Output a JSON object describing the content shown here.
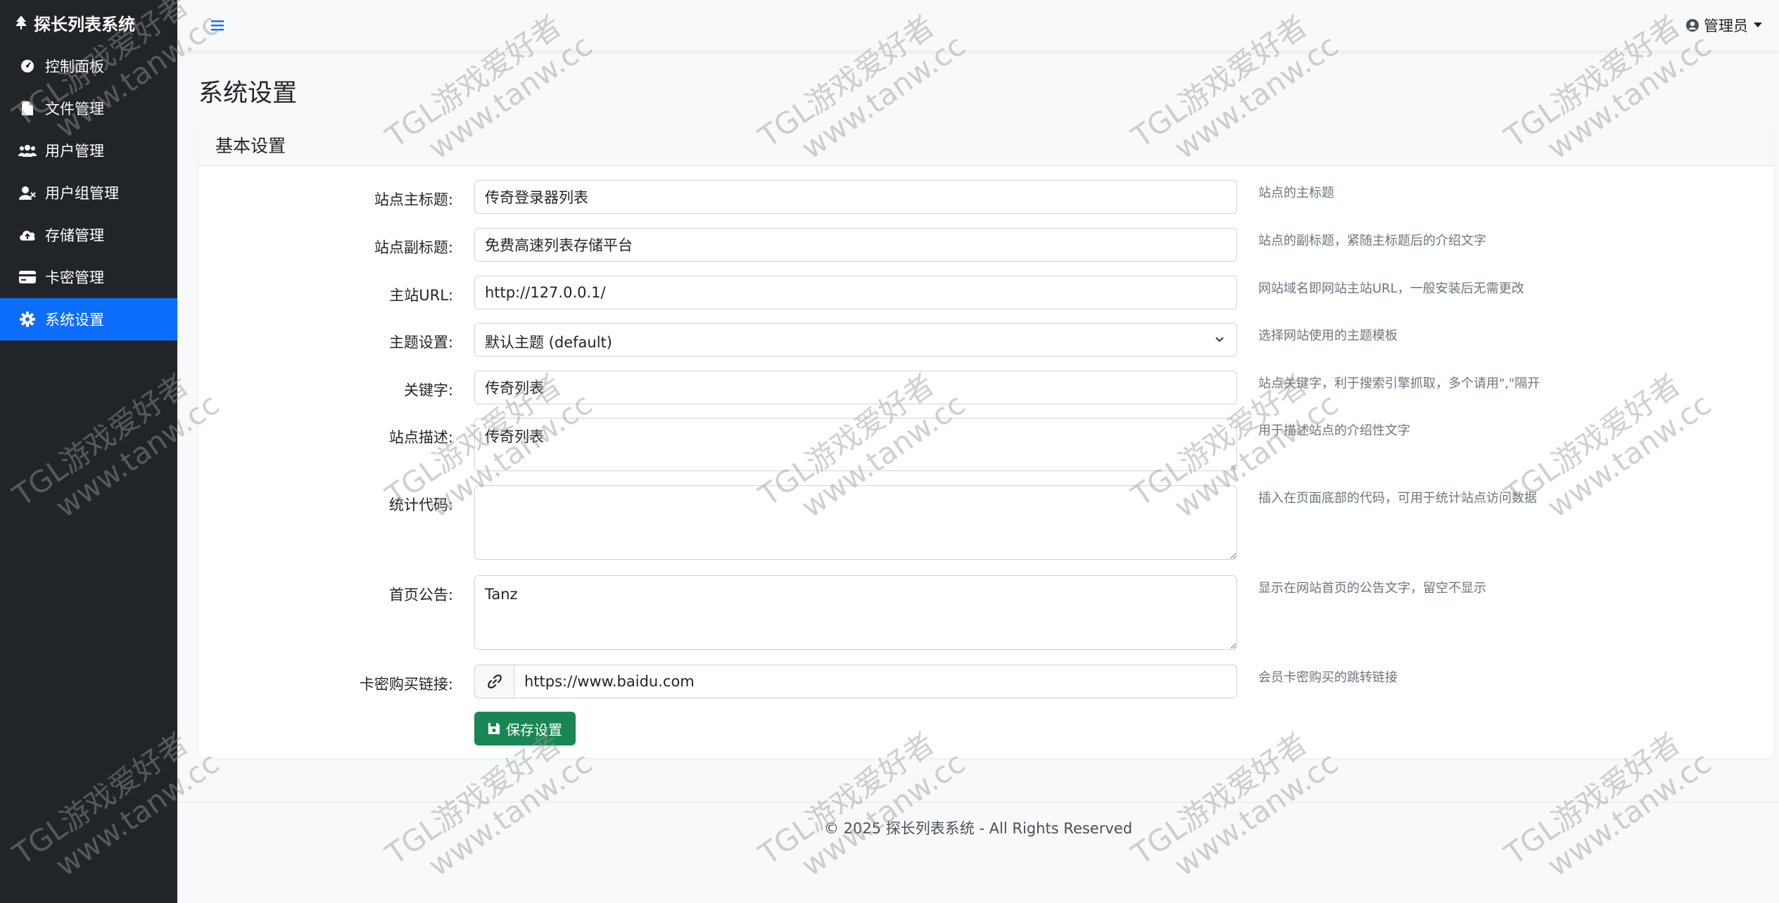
{
  "app": {
    "brand": "探长列表系统",
    "user_label": "管理员"
  },
  "sidebar": {
    "items": [
      {
        "label": "控制面板",
        "icon": "dashboard-icon"
      },
      {
        "label": "文件管理",
        "icon": "file-icon"
      },
      {
        "label": "用户管理",
        "icon": "users-icon"
      },
      {
        "label": "用户组管理",
        "icon": "user-group-icon"
      },
      {
        "label": "存储管理",
        "icon": "cloud-upload-icon"
      },
      {
        "label": "卡密管理",
        "icon": "card-icon"
      },
      {
        "label": "系统设置",
        "icon": "gear-icon",
        "active": true
      }
    ]
  },
  "page": {
    "title": "系统设置",
    "card_title": "基本设置"
  },
  "form": {
    "site_title": {
      "label": "站点主标题:",
      "value": "传奇登录器列表",
      "help": "站点的主标题"
    },
    "site_subtitle": {
      "label": "站点副标题:",
      "value": "免费高速列表存储平台",
      "help": "站点的副标题，紧随主标题后的介绍文字"
    },
    "site_url": {
      "label": "主站URL:",
      "value": "http://127.0.0.1/",
      "help": "网站域名即网站主站URL，一般安装后无需更改"
    },
    "theme": {
      "label": "主题设置:",
      "value": "默认主题 (default)",
      "help": "选择网站使用的主题模板"
    },
    "keywords": {
      "label": "关键字:",
      "value": "传奇列表",
      "help": "站点关键字，利于搜索引擎抓取，多个请用\",\"隔开"
    },
    "description": {
      "label": "站点描述:",
      "value": "传奇列表",
      "help": "用于描述站点的介绍性文字"
    },
    "stats_code": {
      "label": "统计代码:",
      "value": "",
      "help": "插入在页面底部的代码，可用于统计站点访问数据"
    },
    "notice": {
      "label": "首页公告:",
      "value": "Tanz",
      "help": "显示在网站首页的公告文字，留空不显示"
    },
    "card_link": {
      "label": "卡密购买链接:",
      "value": "https://www.baidu.com",
      "help": "会员卡密购买的跳转链接"
    },
    "save_label": "保存设置"
  },
  "footer": {
    "text": "© 2025 探长列表系统 - All Rights Reserved"
  },
  "watermark": {
    "line1": "TGL游戏爱好者",
    "line2": "www.tanw.cc"
  },
  "colors": {
    "sidebar_bg": "#212529",
    "active": "#0d6efd",
    "save": "#198754"
  }
}
